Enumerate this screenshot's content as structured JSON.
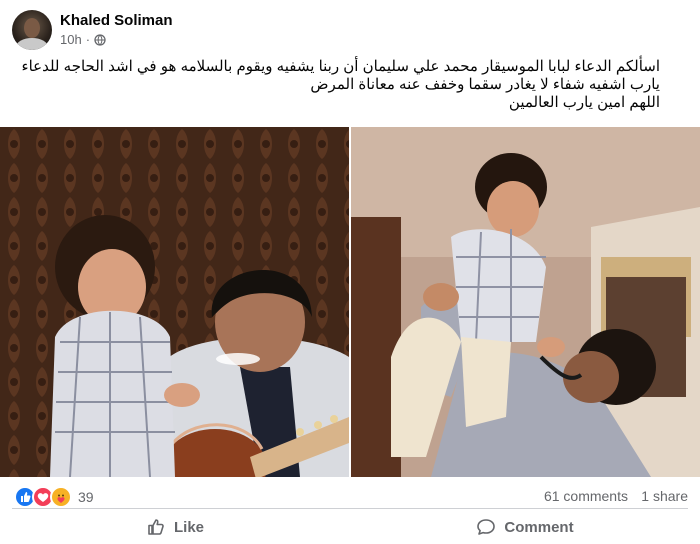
{
  "post": {
    "author": "Khaled Soliman",
    "time": "10h",
    "privacy_icon": "globe-icon",
    "text_lines": [
      "اسألكم الدعاء لبابا الموسيقار محمد علي سليمان أن ربنا يشفيه ويقوم بالسلامه هو في اشد الحاجه للدعاء",
      "يارب اشفيه شفاء لا يغادر سقما وخفف عنه معاناة المرض",
      "اللهم امين يارب العالمين"
    ]
  },
  "stats": {
    "reactions_count": "39",
    "reaction_icons": [
      "like-icon",
      "love-icon",
      "care-icon"
    ],
    "comments": "61 comments",
    "shares": "1 share"
  },
  "actions": {
    "like": "Like",
    "comment": "Comment"
  },
  "colors": {
    "text_primary": "#050505",
    "text_secondary": "#65676b",
    "like_blue": "#1877f2",
    "love_red": "#f33e58",
    "care_yellow": "#f7b125",
    "divider": "#ced0d4"
  }
}
